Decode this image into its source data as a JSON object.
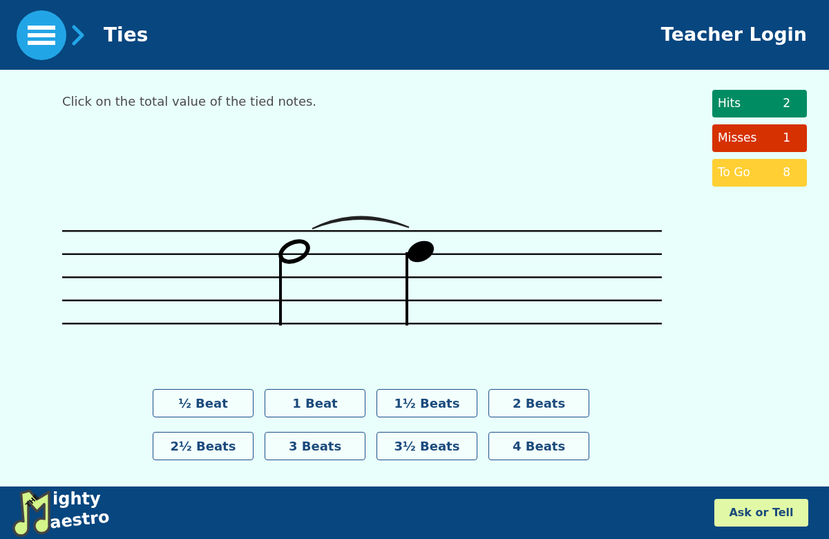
{
  "header": {
    "title": "Ties",
    "login": "Teacher Login"
  },
  "instruction": "Click on the total value of the tied notes.",
  "scores": [
    {
      "label": "Hits",
      "value": "2",
      "color": "#008c62"
    },
    {
      "label": "Misses",
      "value": "1",
      "color": "#d63100"
    },
    {
      "label": "To Go",
      "value": "8",
      "color": "#ffcf33"
    }
  ],
  "notes": [
    {
      "kind": "half"
    },
    {
      "kind": "quarter"
    }
  ],
  "answers": [
    "½ Beat",
    "1 Beat",
    "1½ Beats",
    "2 Beats",
    "2½ Beats",
    "3 Beats",
    "3½ Beats",
    "4 Beats"
  ],
  "logo": {
    "small": "THE",
    "line1": "ighty",
    "line2": "aestro"
  },
  "footer": {
    "button": "Ask or Tell"
  }
}
